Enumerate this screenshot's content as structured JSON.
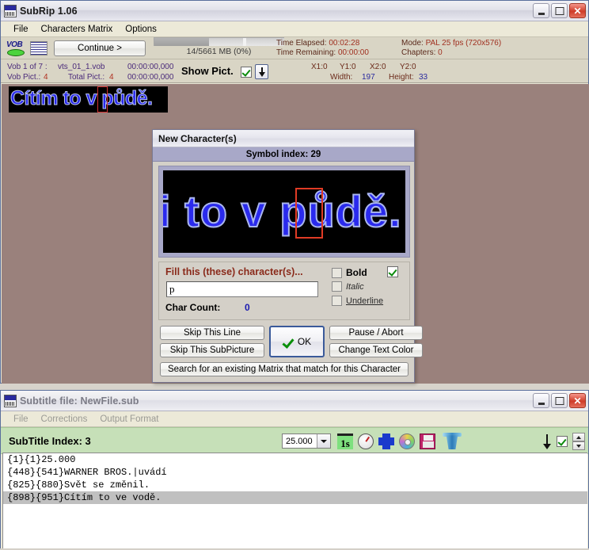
{
  "main_window": {
    "title": "SubRip 1.06",
    "menu": [
      "File",
      "Characters Matrix",
      "Options"
    ],
    "toolbar": {
      "vob_icon": "vob-icon",
      "matrix_icon": "characters-matrix-icon",
      "continue_label": "Continue  >",
      "progress_label": "14/5661 MB (0%)",
      "time_elapsed_label": "Time Elapsed:",
      "time_elapsed_value": "00:02:28",
      "time_remaining_label": "Time Remaining:",
      "time_remaining_value": "00:00:00",
      "mode_label": "Mode:",
      "mode_value": "PAL 25 fps (720x576)",
      "chapters_label": "Chapters:",
      "chapters_value": "0"
    },
    "info_row": {
      "vob_of": "Vob 1 of 7 :",
      "vob_name": "vts_01_1.vob",
      "vob_pict_label": "Vob Pict.:",
      "vob_pict_value": "4",
      "total_pict_label": "Total Pict.:",
      "total_pict_value": "4",
      "time_start": "00:00:00,000",
      "time_end": "00:00:00,000",
      "show_pict_label": "Show Pict.",
      "x1_label": "X1:0",
      "y1_label": "Y1:0",
      "x2_label": "X2:0",
      "y2_label": "Y2:0",
      "width_label": "Width:",
      "width_value": "197",
      "height_label": "Height:",
      "height_value": "33"
    },
    "preview": {
      "subtitle_text": "Cítím to v půdě."
    }
  },
  "dialog": {
    "title": "New Character(s)",
    "symbol_index": "Symbol index: 29",
    "preview_text": "i to v půdě.",
    "fill_label": "Fill this (these) character(s)...",
    "fill_value": "p",
    "char_count_label": "Char Count:",
    "char_count_value": "0",
    "styles": {
      "bold": "Bold",
      "italic": "Italic",
      "underline": "Underline"
    },
    "buttons": {
      "skip_line": "Skip This Line",
      "skip_subpicture": "Skip This SubPicture",
      "ok": "OK",
      "pause_abort": "Pause / Abort",
      "change_text_color": "Change Text Color",
      "search_matrix": "Search for an existing Matrix that match for this Character"
    }
  },
  "subtitle_window": {
    "title": "Subtitle file: NewFile.sub",
    "menu": [
      "File",
      "Corrections",
      "Output Format"
    ],
    "index_label": "SubTitle Index: 3",
    "fps_value": "25.000",
    "icons": [
      "time-shift-icon",
      "clock-icon",
      "puzzle-icon",
      "disc-icon",
      "save-icon",
      "trash-icon"
    ],
    "lines": [
      {
        "text": "{1}{1}25.000",
        "selected": false
      },
      {
        "text": "{448}{541}WARNER BROS.|uvádí",
        "selected": false
      },
      {
        "text": "{825}{880}Svět se změnil.",
        "selected": false
      },
      {
        "text": "{898}{951}Cítím to ve vodě.",
        "selected": true
      }
    ]
  },
  "colors": {
    "accent_blue": "#2a2aee",
    "marker_red": "#e03b25",
    "toolbar_green": "#c6e0b8",
    "preview_bg": "#9a817c"
  }
}
